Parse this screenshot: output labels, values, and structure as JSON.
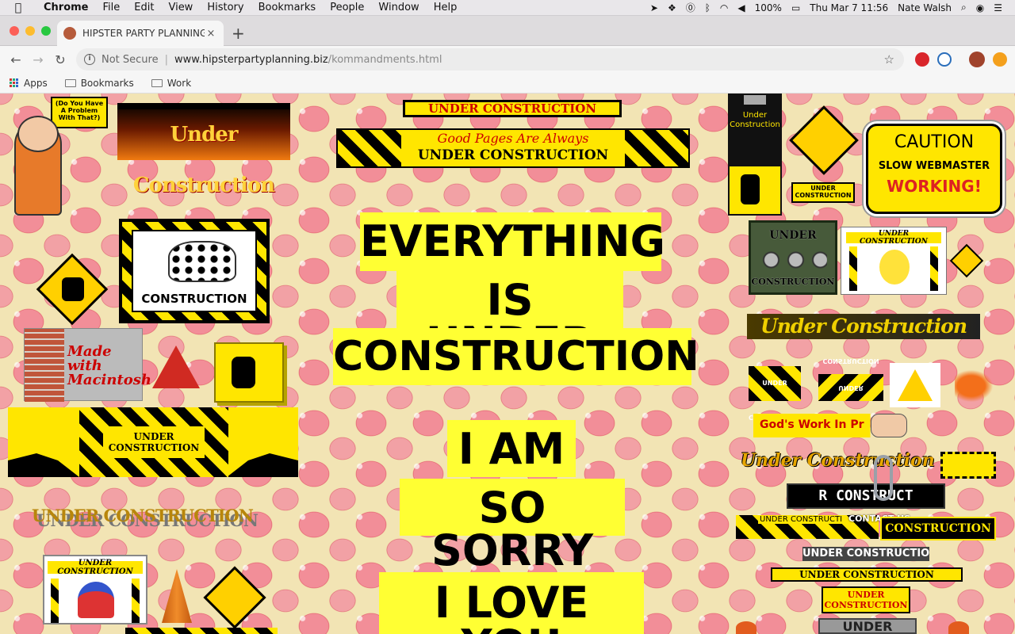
{
  "menubar": {
    "app": "Chrome",
    "items": [
      "File",
      "Edit",
      "View",
      "History",
      "Bookmarks",
      "People",
      "Window",
      "Help"
    ],
    "battery": "100%",
    "clock": "Thu Mar 7  11:56",
    "user": "Nate Walsh"
  },
  "tab": {
    "title": "HIPSTER PARTY PLANNING DC",
    "close": "×",
    "newtab": "+"
  },
  "toolbar": {
    "security": "Not Secure",
    "url_domain": "www.hipsterpartyplanning.biz",
    "url_path": "/kommandments.html"
  },
  "bookmarks": [
    "Apps",
    "Bookmarks",
    "Work"
  ],
  "page": {
    "gifs": {
      "problem_sign": "(Do You Have A Problem With That?)",
      "under_construction_fire": "Under Construction",
      "uc_top_banner": "UNDER CONSTRUCTION",
      "good_pages_line1": "Good Pages Are Always",
      "good_pages_line2": "UNDER CONSTRUCTION",
      "dalmatian_caption": "CONSTRUCTION",
      "made_with_1": "Made",
      "made_with_2": "with",
      "made_with_3": "Macintosh",
      "big_uc_1": "UNDER",
      "big_uc_2": "CONSTRUCTION",
      "uc_shadow": "UNDER CONSTRUCTION",
      "uc_small_banner": "UNDER CONSTRUCTION",
      "uc_tall_1": "Under",
      "uc_tall_2": "Construction",
      "uc_diamond": "UNDER CONSTRUCTION",
      "caution_1": "CAUTION",
      "caution_2": "SLOW WEBMASTER",
      "caution_3": "WORKING!",
      "gears_1": "UNDER",
      "gears_2": "CONSTRUCTION",
      "pikachu": "UNDER CONSTRUCTION",
      "italic_uc": "Under Construction",
      "small_uc_a": "UNDER CONSTRUCTION",
      "small_uc_b": "UNDER CONSTRUCTION",
      "gods_work": "God's Work In Pr",
      "script_uc": "Under Construction",
      "led_uc": "R CONSTRUCT",
      "contact_us": "CONTACT US",
      "uc_mini": "UNDER CONSTRUCTI",
      "construction_red": "CONSTRUCTION",
      "uc_grey": "UNDER CONSTRUCTION",
      "uc_balls": "UNDER CONSTRUCTION",
      "uc_red_1": "UNDER",
      "uc_red_2": "CONSTRUCTION",
      "uc_bottom": "UNDER"
    },
    "message": {
      "line1": "EVERYTHING",
      "line2": "IS UNDER",
      "line3": "CONSTRUCTION",
      "line4": "I AM",
      "line5": "SO SORRY",
      "line6": "I LOVE YOU"
    }
  }
}
